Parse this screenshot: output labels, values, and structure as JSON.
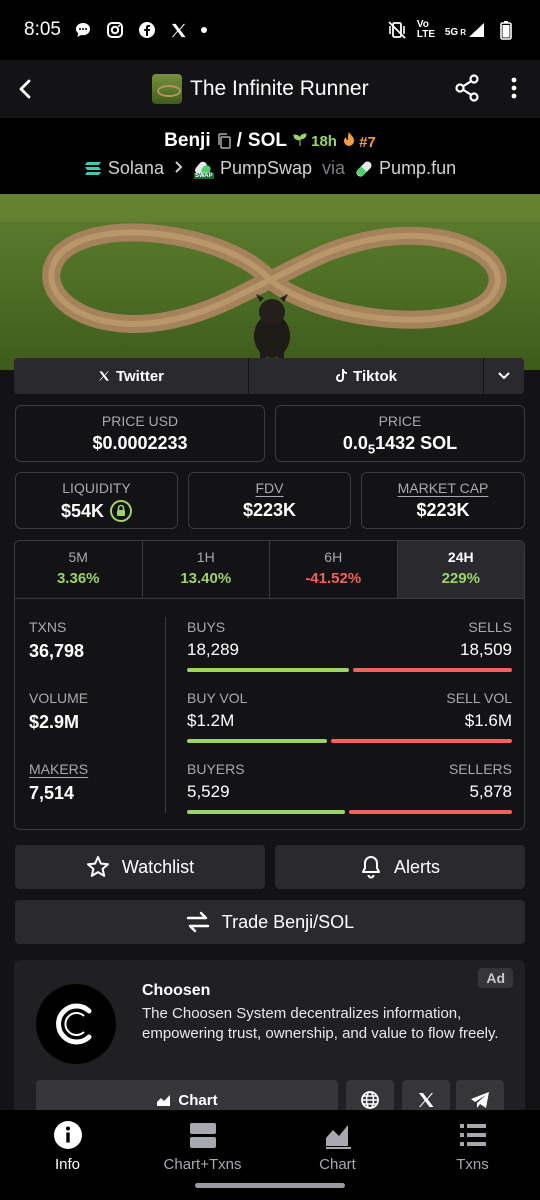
{
  "status_bar": {
    "time": "8:05",
    "signal_label": "5G",
    "volte_label": "Vo LTE",
    "roaming_label": "R"
  },
  "top_bar": {
    "title": "The Infinite Runner"
  },
  "pair": {
    "base": "Benji",
    "separator": "/",
    "quote": "SOL",
    "age": "18h",
    "rank": "#7",
    "chain": "Solana",
    "dex": "PumpSwap",
    "via_label": "via",
    "launchpad": "Pump.fun",
    "swap_badge": "SWAP"
  },
  "social": {
    "twitter_label": "Twitter",
    "tiktok_label": "Tiktok"
  },
  "metrics": {
    "price_usd_label": "PRICE USD",
    "price_usd": "$0.0002233",
    "price_label": "PRICE",
    "price_prefix": "0.0",
    "price_subscript": "5",
    "price_suffix": "1432 SOL",
    "liquidity_label": "LIQUIDITY",
    "liquidity": "$54K",
    "fdv_label": "FDV",
    "fdv": "$223K",
    "mcap_label": "MARKET CAP",
    "mcap": "$223K"
  },
  "changes": [
    {
      "label": "5M",
      "value": "3.36%"
    },
    {
      "label": "1H",
      "value": "13.40%"
    },
    {
      "label": "6H",
      "value": "-41.52%"
    },
    {
      "label": "24H",
      "value": "229%"
    }
  ],
  "stats": {
    "txns_label": "TXNS",
    "txns": "36,798",
    "volume_label": "VOLUME",
    "volume": "$2.9M",
    "makers_label": "MAKERS",
    "makers": "7,514",
    "buys_label": "BUYS",
    "buys": "18,289",
    "sells_label": "SELLS",
    "sells": "18,509",
    "buy_vol_label": "BUY VOL",
    "buy_vol": "$1.2M",
    "sell_vol_label": "SELL VOL",
    "sell_vol": "$1.6M",
    "buyers_label": "BUYERS",
    "buyers": "5,529",
    "sellers_label": "SELLERS",
    "sellers": "5,878",
    "buys_share": 0.497,
    "buy_vol_share": 0.43,
    "buyers_share": 0.485
  },
  "actions": {
    "watchlist_label": "Watchlist",
    "alerts_label": "Alerts",
    "trade_label": "Trade Benji/SOL"
  },
  "ad": {
    "badge": "Ad",
    "title": "Choosen",
    "description": "The Choosen System decentralizes information, empowering trust, ownership, and value to flow freely.",
    "chart_label": "Chart"
  },
  "bottom_nav": [
    {
      "label": "Info",
      "icon": "info-icon"
    },
    {
      "label": "Chart+Txns",
      "icon": "chart-txns-icon"
    },
    {
      "label": "Chart",
      "icon": "chart-icon"
    },
    {
      "label": "Txns",
      "icon": "list-icon"
    }
  ],
  "colors": {
    "positive": "#9bd36a",
    "negative": "#f0625c",
    "rank": "#f39c3f"
  }
}
